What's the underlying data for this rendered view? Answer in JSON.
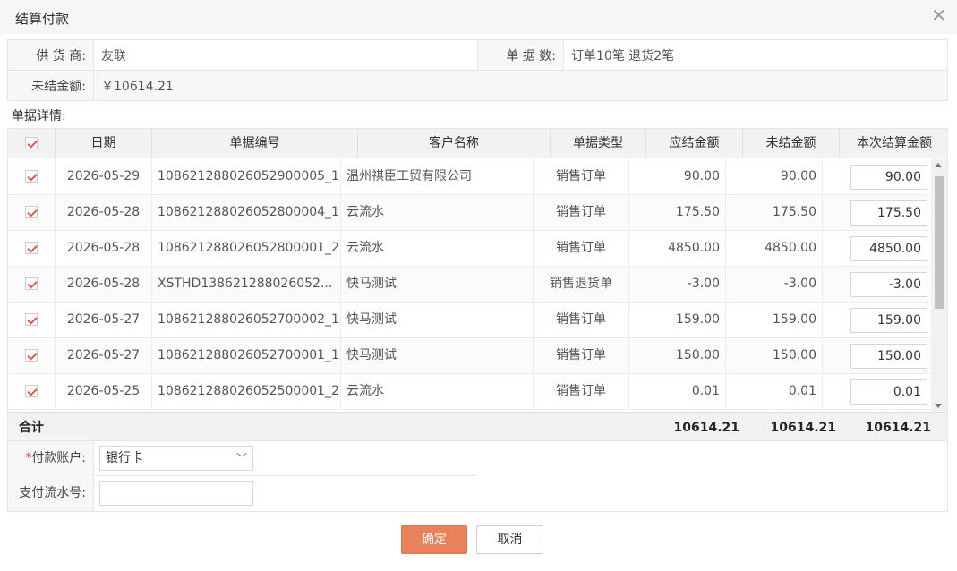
{
  "dialog": {
    "title": "结算付款"
  },
  "info": {
    "supplier_label": "供 货 商:",
    "supplier_value": "友联",
    "doc_count_label": "单 据 数:",
    "doc_count_value": "订单10笔 退货2笔",
    "unsettled_label": "未结金额:",
    "unsettled_value": "￥10614.21"
  },
  "details_label": "单据详情:",
  "table": {
    "columns": [
      "日期",
      "单据编号",
      "客户名称",
      "单据类型",
      "应结金额",
      "未结金额",
      "本次结算金额"
    ],
    "rows": [
      {
        "date": "2026-05-29",
        "no": "108621288026052900005_1",
        "customer": "温州祺臣工贸有限公司",
        "type": "销售订单",
        "due": "90.00",
        "unsettled": "90.00",
        "settle": "90.00"
      },
      {
        "date": "2026-05-28",
        "no": "108621288026052800004_1",
        "customer": "云流水",
        "type": "销售订单",
        "due": "175.50",
        "unsettled": "175.50",
        "settle": "175.50"
      },
      {
        "date": "2026-05-28",
        "no": "108621288026052800001_2",
        "customer": "云流水",
        "type": "销售订单",
        "due": "4850.00",
        "unsettled": "4850.00",
        "settle": "4850.00"
      },
      {
        "date": "2026-05-28",
        "no": "XSTHD138621288026052...",
        "customer": "快马测试",
        "type": "销售退货单",
        "due": "-3.00",
        "unsettled": "-3.00",
        "settle": "-3.00"
      },
      {
        "date": "2026-05-27",
        "no": "108621288026052700002_1",
        "customer": "快马测试",
        "type": "销售订单",
        "due": "159.00",
        "unsettled": "159.00",
        "settle": "159.00"
      },
      {
        "date": "2026-05-27",
        "no": "108621288026052700001_1",
        "customer": "快马测试",
        "type": "销售订单",
        "due": "150.00",
        "unsettled": "150.00",
        "settle": "150.00"
      },
      {
        "date": "2026-05-25",
        "no": "108621288026052500001_2",
        "customer": "云流水",
        "type": "销售订单",
        "due": "0.01",
        "unsettled": "0.01",
        "settle": "0.01"
      }
    ],
    "total_label": "合计",
    "total_due": "10614.21",
    "total_unsettled": "10614.21",
    "total_settle": "10614.21"
  },
  "payment": {
    "account_label": "付款账户:",
    "account_required_mark": "*",
    "account_value": "银行卡",
    "serial_label": "支付流水号:",
    "serial_value": ""
  },
  "buttons": {
    "ok": "确定",
    "cancel": "取消"
  },
  "colors": {
    "accent": "#e9825b",
    "amount_red": "#e8362a",
    "check_red": "#e05a47"
  }
}
